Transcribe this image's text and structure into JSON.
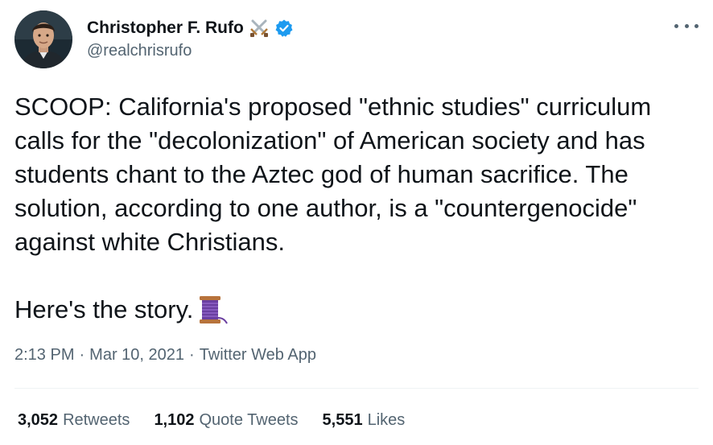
{
  "author": {
    "display_name": "Christopher F. Rufo",
    "handle": "@realchrisrufo",
    "name_emoji": "crossed-swords-emoji",
    "verified_color": "#1d9bf0"
  },
  "tweet": {
    "text": "SCOOP: California's proposed \"ethnic studies\" curriculum calls for the \"decolonization\" of American society and has students chant to the Aztec god of human sacrifice. The solution, according to one author, is a \"countergenocide\" against white Christians.",
    "story_line": "Here's the story.",
    "story_emoji": "thread-spool-emoji"
  },
  "meta": {
    "time": "2:13 PM",
    "separator": "·",
    "date": "Mar 10, 2021",
    "source": "Twitter Web App"
  },
  "stats": {
    "retweets_count": "3,052",
    "retweets_label": "Retweets",
    "quotes_count": "1,102",
    "quotes_label": "Quote Tweets",
    "likes_count": "5,551",
    "likes_label": "Likes"
  },
  "colors": {
    "text_primary": "#0f1419",
    "text_secondary": "#536471",
    "divider": "#eff3f4"
  }
}
